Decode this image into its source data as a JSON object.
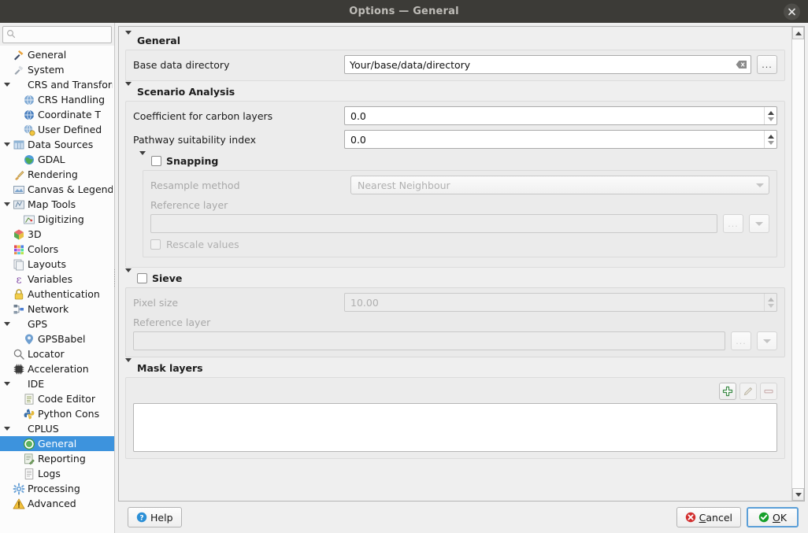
{
  "window": {
    "title": "Options — General",
    "close_icon": "close-icon"
  },
  "sidebar": {
    "search": {
      "value": "",
      "placeholder": "",
      "icon": "search-icon"
    },
    "items": [
      {
        "label": "General",
        "icon": "hammer-wrench-icon",
        "level": 0,
        "arrow": false,
        "selected": false
      },
      {
        "label": "System",
        "icon": "system-tools-icon",
        "level": 0,
        "arrow": false,
        "selected": false
      },
      {
        "label": "CRS and Transform",
        "icon": "",
        "level": 0,
        "arrow": true,
        "selected": false
      },
      {
        "label": "CRS Handling",
        "icon": "globe-icon",
        "level": 1,
        "arrow": false,
        "selected": false
      },
      {
        "label": "Coordinate T",
        "icon": "globe-blue-icon",
        "level": 1,
        "arrow": false,
        "selected": false
      },
      {
        "label": "User Defined",
        "icon": "globe-gear-icon",
        "level": 1,
        "arrow": false,
        "selected": false
      },
      {
        "label": "Data Sources",
        "icon": "table-icon",
        "level": 0,
        "arrow": true,
        "selected": false
      },
      {
        "label": "GDAL",
        "icon": "globe-green-icon",
        "level": 1,
        "arrow": false,
        "selected": false
      },
      {
        "label": "Rendering",
        "icon": "brush-icon",
        "level": 0,
        "arrow": false,
        "selected": false
      },
      {
        "label": "Canvas & Legend",
        "icon": "canvas-icon",
        "level": 0,
        "arrow": false,
        "selected": false
      },
      {
        "label": "Map Tools",
        "icon": "map-tools-icon",
        "level": 0,
        "arrow": true,
        "selected": false
      },
      {
        "label": "Digitizing",
        "icon": "digitizing-icon",
        "level": 1,
        "arrow": false,
        "selected": false
      },
      {
        "label": "3D",
        "icon": "cube-icon",
        "level": 0,
        "arrow": false,
        "selected": false
      },
      {
        "label": "Colors",
        "icon": "color-grid-icon",
        "level": 0,
        "arrow": false,
        "selected": false
      },
      {
        "label": "Layouts",
        "icon": "layouts-icon",
        "level": 0,
        "arrow": false,
        "selected": false
      },
      {
        "label": "Variables",
        "icon": "epsilon-icon",
        "level": 0,
        "arrow": false,
        "selected": false
      },
      {
        "label": "Authentication",
        "icon": "lock-icon",
        "level": 0,
        "arrow": false,
        "selected": false
      },
      {
        "label": "Network",
        "icon": "network-icon",
        "level": 0,
        "arrow": false,
        "selected": false
      },
      {
        "label": "GPS",
        "icon": "",
        "level": 0,
        "arrow": true,
        "selected": false
      },
      {
        "label": "GPSBabel",
        "icon": "gpsbabel-icon",
        "level": 1,
        "arrow": false,
        "selected": false
      },
      {
        "label": "Locator",
        "icon": "search-icon",
        "level": 0,
        "arrow": false,
        "selected": false
      },
      {
        "label": "Acceleration",
        "icon": "chip-icon",
        "level": 0,
        "arrow": false,
        "selected": false
      },
      {
        "label": "IDE",
        "icon": "",
        "level": 0,
        "arrow": true,
        "selected": false
      },
      {
        "label": "Code Editor",
        "icon": "code-editor-icon",
        "level": 1,
        "arrow": false,
        "selected": false
      },
      {
        "label": "Python Cons",
        "icon": "python-icon",
        "level": 1,
        "arrow": false,
        "selected": false
      },
      {
        "label": "CPLUS",
        "icon": "",
        "level": 0,
        "arrow": true,
        "selected": false
      },
      {
        "label": "General",
        "icon": "cplus-icon",
        "level": 1,
        "arrow": false,
        "selected": true
      },
      {
        "label": "Reporting",
        "icon": "reporting-icon",
        "level": 1,
        "arrow": false,
        "selected": false
      },
      {
        "label": "Logs",
        "icon": "logs-icon",
        "level": 1,
        "arrow": false,
        "selected": false
      },
      {
        "label": "Processing",
        "icon": "gear-icon",
        "level": 0,
        "arrow": false,
        "selected": false
      },
      {
        "label": "Advanced",
        "icon": "warning-icon",
        "level": 0,
        "arrow": false,
        "selected": false
      }
    ]
  },
  "main": {
    "general": {
      "title": "General",
      "base_dir_label": "Base data directory",
      "base_dir_value": "Your/base/data/directory",
      "clear_icon": "clear-icon",
      "browse_label": "..."
    },
    "scenario": {
      "title": "Scenario Analysis",
      "carbon_label": "Coefficient for carbon layers",
      "carbon_value": "0.0",
      "pathway_label": "Pathway suitability index",
      "pathway_value": "0.0",
      "snapping": {
        "title": "Snapping",
        "checked": false,
        "resample_label": "Resample method",
        "resample_value": "Nearest Neighbour",
        "reference_label": "Reference layer",
        "reference_value": "",
        "browse_label": "...",
        "rescale_label": "Rescale values",
        "rescale_checked": false
      }
    },
    "sieve": {
      "title": "Sieve",
      "checked": false,
      "pixel_label": "Pixel size",
      "pixel_value": "10.00",
      "reference_label": "Reference layer",
      "reference_value": "",
      "browse_label": "..."
    },
    "mask": {
      "title": "Mask layers",
      "add_icon": "add-icon",
      "edit_icon": "edit-pencil-icon",
      "remove_icon": "remove-icon",
      "items": []
    }
  },
  "footer": {
    "help_label": "Help",
    "help_icon": "help-icon",
    "cancel_label": "Cancel",
    "cancel_icon": "cancel-icon",
    "ok_label": "OK",
    "ok_icon": "ok-icon"
  },
  "colors": {
    "titlebar": "#3c3b37",
    "selection": "#3d93dd",
    "panel": "#efefef",
    "group": "#eaeaea",
    "accent_ok": "#1f9a33",
    "accent_cancel": "#d02b2b"
  }
}
